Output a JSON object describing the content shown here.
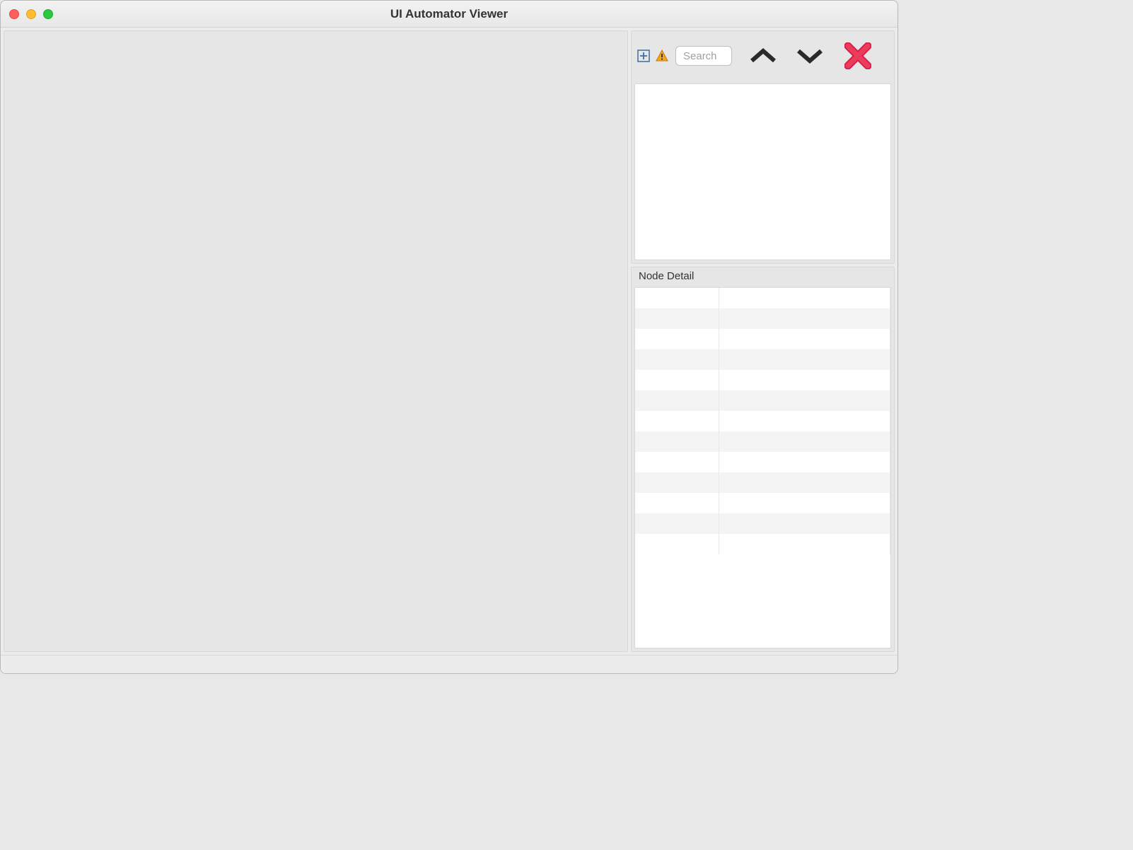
{
  "window": {
    "title": "UI Automator Viewer"
  },
  "toolbar": {
    "search_placeholder": "Search"
  },
  "detail": {
    "header": "Node Detail",
    "rows": [
      {
        "key": "",
        "value": ""
      },
      {
        "key": "",
        "value": ""
      },
      {
        "key": "",
        "value": ""
      },
      {
        "key": "",
        "value": ""
      },
      {
        "key": "",
        "value": ""
      },
      {
        "key": "",
        "value": ""
      },
      {
        "key": "",
        "value": ""
      },
      {
        "key": "",
        "value": ""
      },
      {
        "key": "",
        "value": ""
      },
      {
        "key": "",
        "value": ""
      },
      {
        "key": "",
        "value": ""
      },
      {
        "key": "",
        "value": ""
      },
      {
        "key": "",
        "value": ""
      }
    ]
  }
}
